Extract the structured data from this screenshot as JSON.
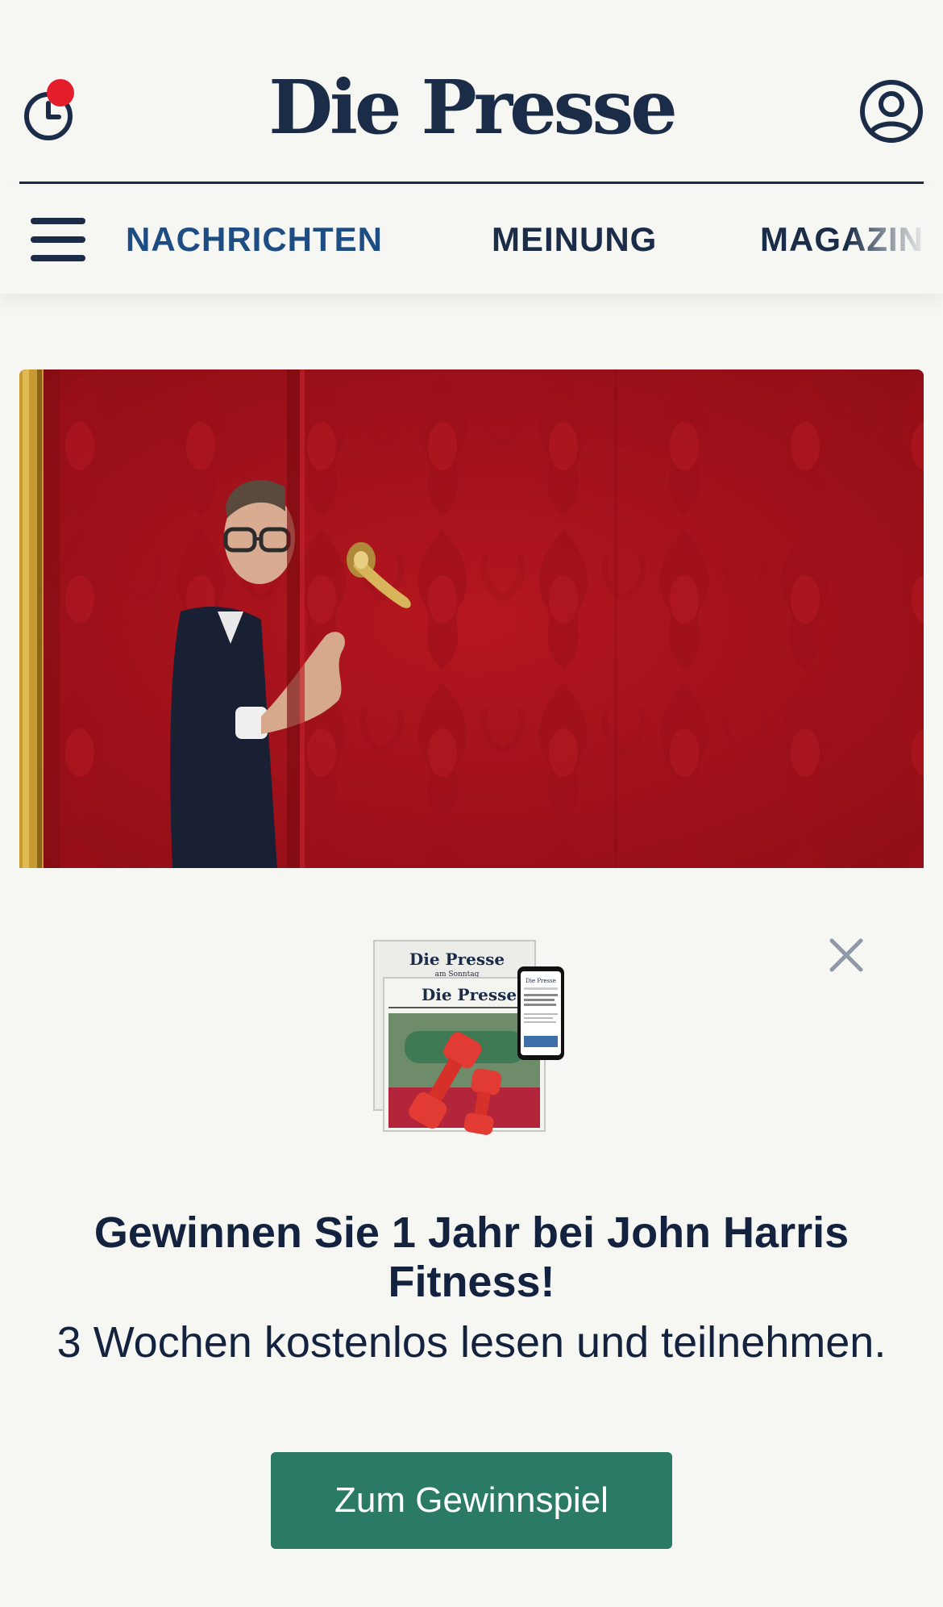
{
  "header": {
    "brand": "Die Presse",
    "history_icon": "clock-icon",
    "account_icon": "user-circle-icon",
    "notification_color": "#e31d2b"
  },
  "nav": {
    "menu_icon": "hamburger-icon",
    "items": [
      {
        "label": "NACHRICHTEN",
        "active": true
      },
      {
        "label": "MEINUNG",
        "active": false
      },
      {
        "label": "MAGAZIN",
        "active": false
      }
    ]
  },
  "hero": {
    "image": "man-peeking-behind-red-damask-door"
  },
  "promo": {
    "close_icon": "close-icon",
    "image": "newspaper-and-dumbbells-illustration",
    "image_text": {
      "paper_sunday": "Die Presse",
      "paper_sunday_sub": "am Sonntag",
      "paper_daily": "Die Presse",
      "phone_brand": "Die Presse"
    },
    "title": "Gewinnen Sie 1 Jahr bei John Harris Fitness!",
    "subtitle": "3 Wochen kostenlos lesen und teilnehmen.",
    "cta_label": "Zum Gewinnspiel"
  },
  "colors": {
    "navy": "#1b2c48",
    "active_nav": "#1e4d84",
    "cta": "#2a7a66",
    "background": "#f6f6f2"
  }
}
